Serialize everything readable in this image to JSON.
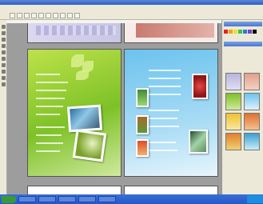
{
  "window": {
    "title": ""
  },
  "menu": {
    "items": []
  },
  "colors": {
    "workspace_bg": "#9d9d9d",
    "green_page": "#7ec127",
    "blue_page": "#6cc3ee"
  },
  "icons": {
    "tools": [
      "pointer-icon",
      "text-icon",
      "rectangle-icon",
      "oval-icon",
      "line-icon",
      "crop-icon",
      "zoom-icon",
      "hand-icon",
      "pen-icon",
      "fill-icon"
    ],
    "toolbar": [
      "new-icon",
      "open-icon",
      "save-icon",
      "print-icon",
      "cut-icon",
      "copy-icon",
      "paste-icon",
      "undo-icon",
      "redo-icon",
      "zoom-icon"
    ]
  },
  "taskbar": {
    "start_label": "",
    "clock": ""
  }
}
